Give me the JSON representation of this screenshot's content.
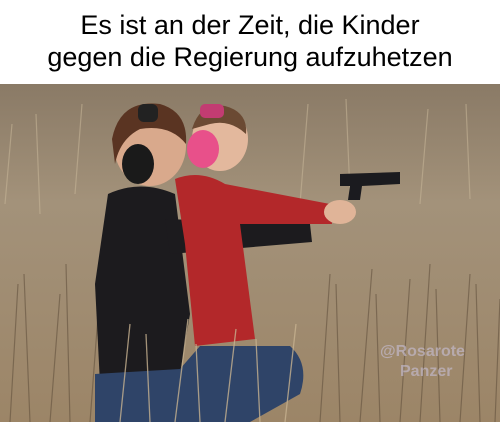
{
  "caption": {
    "line1": "Es ist an der Zeit, die Kinder",
    "line2": "gegen die Regierung aufzuhetzen"
  },
  "watermark": {
    "line1": "@Rosarote",
    "line2": "Panzer"
  },
  "colors": {
    "grass": "#a08b6c",
    "grass_dark": "#6f5c45",
    "jacket_red": "#b3282a",
    "earmuff_pink": "#e8508a",
    "top_black": "#1c1b1e",
    "jeans_blue": "#2f4468"
  }
}
